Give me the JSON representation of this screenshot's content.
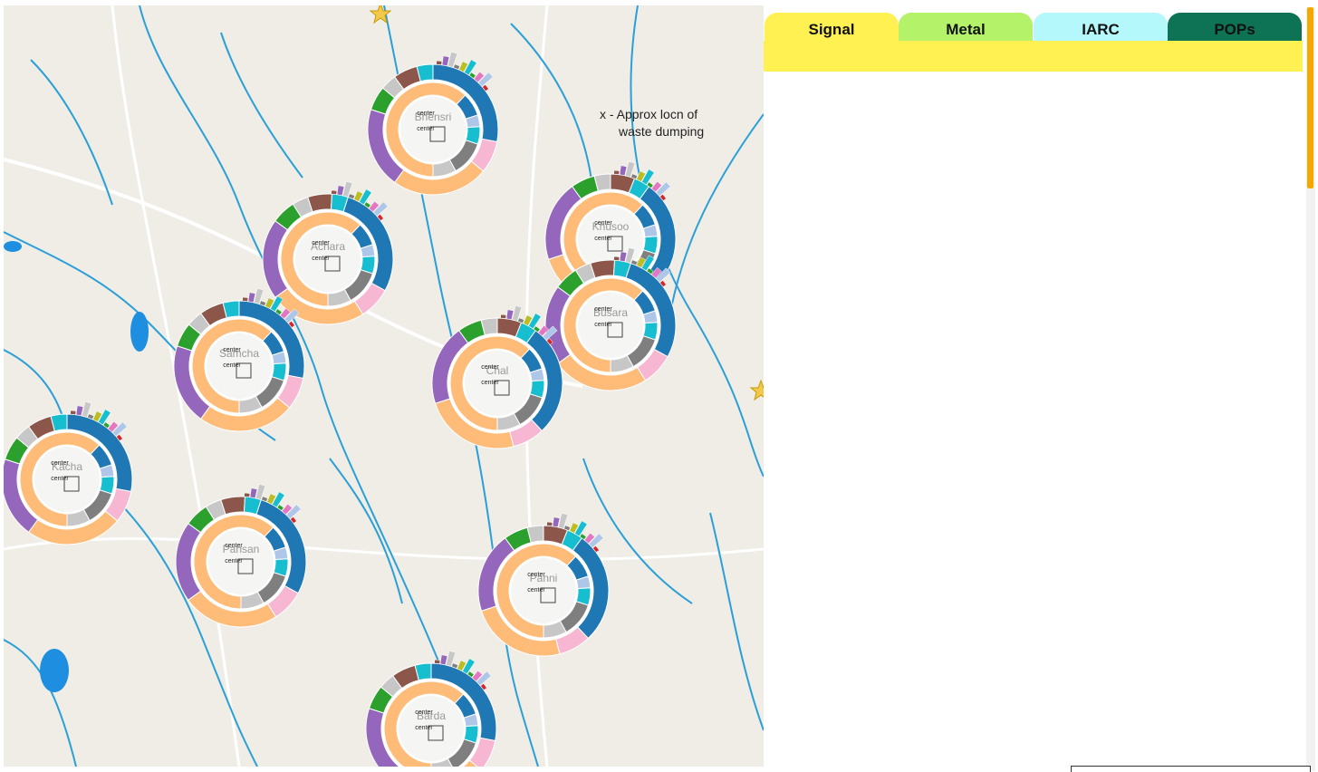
{
  "tabs": [
    {
      "label": "Signal",
      "color": "#fff152"
    },
    {
      "label": "Metal",
      "color": "#b4f26a"
    },
    {
      "label": "IARC",
      "color": "#b4f8fb"
    },
    {
      "label": "POPs",
      "color": "#0e7354"
    }
  ],
  "annotation": {
    "line1": "x - Approx locn of",
    "line2": "waste dumping"
  },
  "center_label": "center",
  "place_labels": [
    "Bhensri",
    "Achara",
    "Khusoo",
    "Samcha",
    "Busara",
    "Chal",
    "Kacha",
    "Pansan",
    "Panni",
    "Barda"
  ],
  "map_colors": {
    "land": "#efede6",
    "river": "#2a9fd8",
    "lake": "#1e8fe0",
    "road": "#ffffff"
  },
  "chart_colors": [
    "#ffbb78",
    "#1f77b4",
    "#f7b6d2",
    "#8c564b",
    "#9467bd",
    "#c7c7c7",
    "#7f7f7f",
    "#bcbd22",
    "#17becf",
    "#2ca02c",
    "#e377c2",
    "#aec7e8",
    "#d62728",
    "#98df8a",
    "#ff7f0e"
  ]
}
